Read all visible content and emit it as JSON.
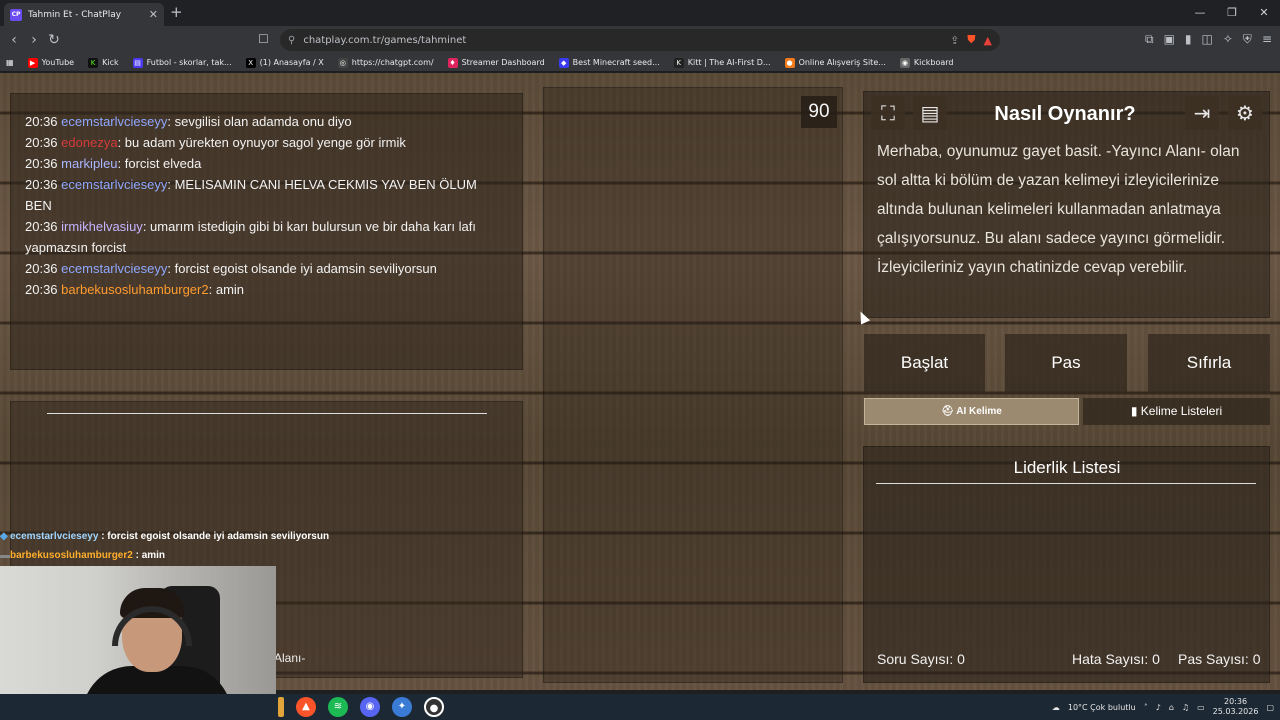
{
  "browser": {
    "tab_title": "Tahmin Et - ChatPlay",
    "tab_favicon": "CP",
    "url": "chatplay.com.tr/games/tahminet",
    "bookmarks": [
      {
        "label": "YouTube",
        "icon": "youtube-icon",
        "color": "#ff0000"
      },
      {
        "label": "Kick",
        "icon": "kick-icon",
        "color": "#53fc18"
      },
      {
        "label": "Futbol - skorlar, tak...",
        "icon": "futbol-icon",
        "color": "#4c3aef"
      },
      {
        "label": "(1) Anasayfa / X",
        "icon": "x-icon",
        "color": "#000000"
      },
      {
        "label": "https://chatgpt.com/",
        "icon": "chatgpt-icon",
        "color": "#ffffff"
      },
      {
        "label": "Streamer Dashboard",
        "icon": "streamer-icon",
        "color": "#e0245e"
      },
      {
        "label": "Best Minecraft seed...",
        "icon": "minecraft-icon",
        "color": "#3a3aef"
      },
      {
        "label": "Kitt | The AI-First D...",
        "icon": "kitt-icon",
        "color": "#222222"
      },
      {
        "label": "Online Alışveriş Site...",
        "icon": "shop-icon",
        "color": "#f27a1a"
      },
      {
        "label": "Kickboard",
        "icon": "kickboard-icon",
        "color": "#666666"
      }
    ]
  },
  "chat": {
    "messages": [
      {
        "time": "20:36",
        "user": "ecemstarlvcieseyy",
        "text": ": sevgilisi olan adamda onu diyo",
        "color": "blue"
      },
      {
        "time": "20:36",
        "user": "edonezya",
        "text": ": bu adam yürekten oynuyor sagol yenge gör irmik",
        "color": "red"
      },
      {
        "time": "20:36",
        "user": "markipleu",
        "text": ": forcist elveda",
        "color": "blue2"
      },
      {
        "time": "20:36",
        "user": "ecemstarlvcieseyy",
        "text": ": MELISAMIN CANI HELVA CEKMIS YAV BEN ÖLUM BEN",
        "color": "blue"
      },
      {
        "time": "20:36",
        "user": "irmikhelvasiuy",
        "text": ": umarım istedigin gibi bi karı bulursun ve bir daha karı lafı yapmazsın forcist",
        "color": "pur"
      },
      {
        "time": "20:36",
        "user": "ecemstarlvcieseyy",
        "text": ": forcist egoist olsande iyi adamsin seviliyorsun",
        "color": "blue"
      },
      {
        "time": "20:36",
        "user": "barbekusosluhamburger2",
        "text": ": amin",
        "color": "org"
      }
    ]
  },
  "overlay_chat": [
    {
      "user": "ecemstarlvcieseyy",
      "text": " : forcist egoist olsande iyi adamsin seviliyorsun"
    },
    {
      "user": "barbekusosluhamburger2",
      "text": " : amin"
    }
  ],
  "lower_left_label": "Alanı-",
  "timer": "90",
  "how_to": {
    "title": "Nasıl Oynanır?",
    "description": "Merhaba, oyunumuz gayet basit. -Yayıncı Alanı- olan sol altta ki bölüm de yazan kelimeyi izleyicilerinize altında bulunan kelimeleri kullanmadan anlatmaya çalışıyorsunuz. Bu alanı sadece yayıncı görmelidir. İzleyicileriniz yayın chatinizde cevap verebilir."
  },
  "buttons": {
    "start": "Başlat",
    "pass": "Pas",
    "reset": "Sıfırla",
    "ai_word": "AI Kelime",
    "word_lists": "Kelime Listeleri"
  },
  "leaderboard": {
    "title": "Liderlik Listesi",
    "question_count_label": "Soru Sayısı:",
    "question_count": "0",
    "error_count_label": "Hata Sayısı:",
    "error_count": "0",
    "pass_count_label": "Pas Sayısı:",
    "pass_count": "0"
  },
  "taskbar": {
    "weather": "10°C  Çok bulutlu",
    "time": "20:36",
    "date": "25.03.2026"
  }
}
